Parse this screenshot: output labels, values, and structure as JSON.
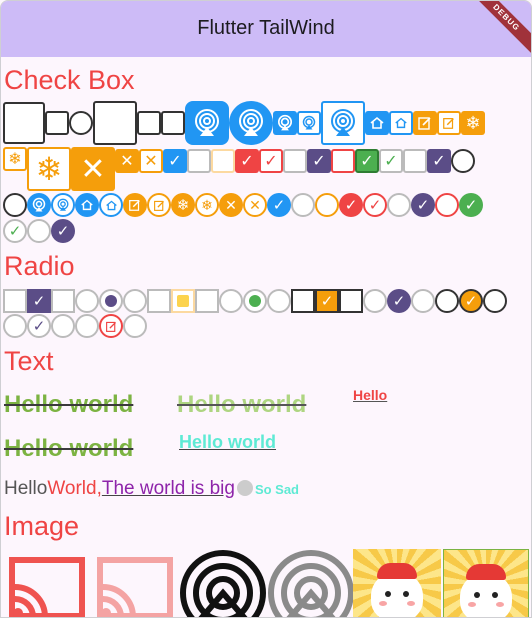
{
  "app": {
    "title": "Flutter TailWind",
    "debug_banner": "DEBUG"
  },
  "sections": {
    "checkbox": "Check Box",
    "radio": "Radio",
    "text": "Text",
    "image": "Image"
  },
  "text_demo": {
    "line1_a": "Hello world",
    "line1_b": "Hello world",
    "line1_sup": "Hello",
    "line2_a": "Hello world",
    "line2_b": "Hello world",
    "line3_hello": "Hello ",
    "line3_world": "World,",
    "line3_link": "The world is big",
    "line3_sad": "So Sad"
  },
  "colors": {
    "appbar": "#cdbbf7",
    "section_title": "#ef4444",
    "blue": "#2196f3",
    "orange": "#f59e0b",
    "red": "#ef4444",
    "purple": "#5b4d87",
    "green": "#4caf50"
  }
}
